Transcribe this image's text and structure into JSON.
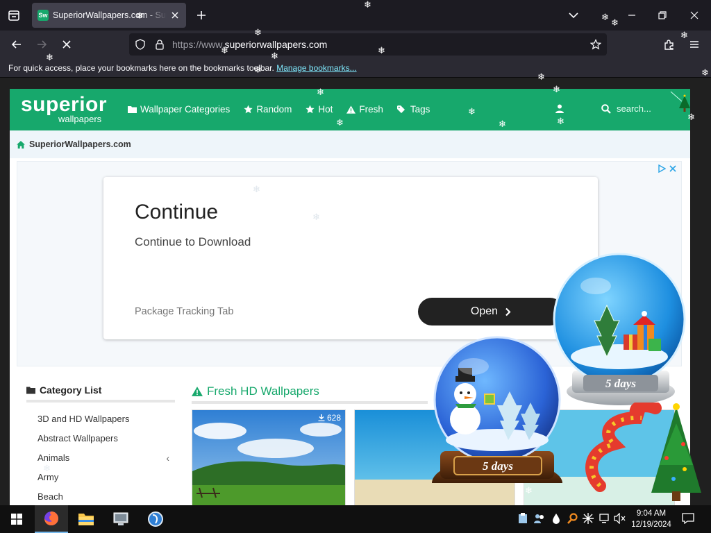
{
  "browser": {
    "tab_title": "SuperiorWallpapers.com - Superior Wallpapers",
    "favicon_text": "Sw",
    "url_prefix": "https://www.",
    "url_domain": "superiorwallpapers.com",
    "bookmarks_prompt": "For quick access, place your bookmarks here on the bookmarks toolbar.",
    "bookmarks_link": "Manage bookmarks..."
  },
  "site": {
    "logo_main": "superior",
    "logo_sub": "wallpapers",
    "menu": [
      {
        "label": "Wallpaper Categories",
        "icon": "folder-icon"
      },
      {
        "label": "Random",
        "icon": "star-icon"
      },
      {
        "label": "Hot",
        "icon": "star-icon"
      },
      {
        "label": "Fresh",
        "icon": "warning-icon"
      },
      {
        "label": "Tags",
        "icon": "tags-icon"
      }
    ],
    "search_placeholder": "search...",
    "breadcrumb": "SuperiorWallpapers.com",
    "brand_color": "#17a86c"
  },
  "ad": {
    "headline": "Continue",
    "subtitle": "Continue to Download",
    "source": "Package Tracking Tab",
    "button": "Open"
  },
  "sidebar": {
    "title": "Category List",
    "categories": [
      "3D and HD Wallpapers",
      "Abstract Wallpapers",
      "Animals",
      "Army",
      "Beach"
    ]
  },
  "fresh": {
    "title": "Fresh HD Wallpapers",
    "thumbs": [
      {
        "downloads": "628"
      }
    ]
  },
  "overlay": {
    "globe_label_1": "5 days",
    "globe_label_2": "5 days"
  },
  "taskbar": {
    "time": "9:04 AM",
    "date": "12/19/2024"
  }
}
